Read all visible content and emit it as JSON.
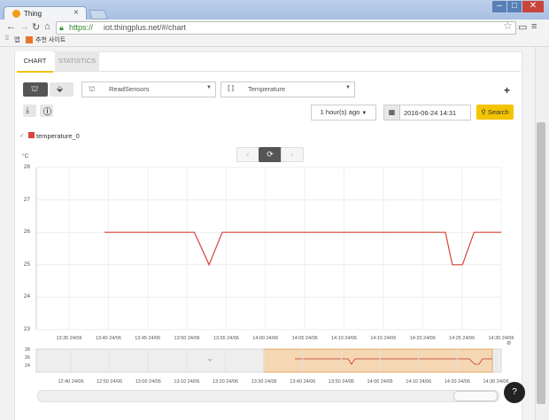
{
  "browser": {
    "tab_title": "Thing",
    "tab_close": "×",
    "url_https": "https://",
    "url_rest": "iot.thingplus.net/#/chart",
    "bookmarks": [
      "앱",
      "추천 사이트"
    ],
    "window_buttons": [
      "–",
      "□",
      "✕"
    ]
  },
  "page_tabs": [
    "CHART",
    "STATISTICS"
  ],
  "controls": {
    "sensor_select": "ReadSensors",
    "type_select": "Temperature",
    "add_button": "+",
    "time_range": "1 hour(s) ago",
    "date_value": "2016-06-24 14:31",
    "search_label": "Search"
  },
  "legend": {
    "series_name": "temperature_0",
    "color": "#d9443a"
  },
  "chart_data": {
    "type": "line",
    "ylabel": "°C",
    "ylim": [
      23,
      28
    ],
    "yticks": [
      23,
      24,
      25,
      26,
      27,
      28
    ],
    "xticks": [
      "13:35 24/06",
      "13:40 24/06",
      "13:45 24/06",
      "13:50 24/06",
      "13:55 24/06",
      "14:00 24/06",
      "14:05 24/06",
      "14:10 24/06",
      "14:15 24/06",
      "14:20 24/06",
      "14:25 24/06",
      "14:30 24/06"
    ],
    "xlim_minutes": [
      0,
      60
    ],
    "series": [
      {
        "name": "temperature_0",
        "x_minutes": [
          8.8,
          20.4,
          22.3,
          24.0,
          52.8,
          53.7,
          55.0,
          56.5,
          60.0
        ],
        "values": [
          26,
          26,
          25,
          26,
          26,
          25,
          25,
          26,
          26
        ]
      }
    ]
  },
  "navigator": {
    "yticks": [
      28,
      26,
      24
    ],
    "xticks": [
      "12:40 24/06",
      "12:50 24/06",
      "13:00 24/06",
      "13:10 24/06",
      "13:20 24/06",
      "13:30 24/06",
      "13:40 24/06",
      "13:50 24/06",
      "14:00 24/06",
      "14:10 24/06",
      "14:20 24/06",
      "14:30 24/06"
    ],
    "selection_color": "#f6d7b3"
  }
}
